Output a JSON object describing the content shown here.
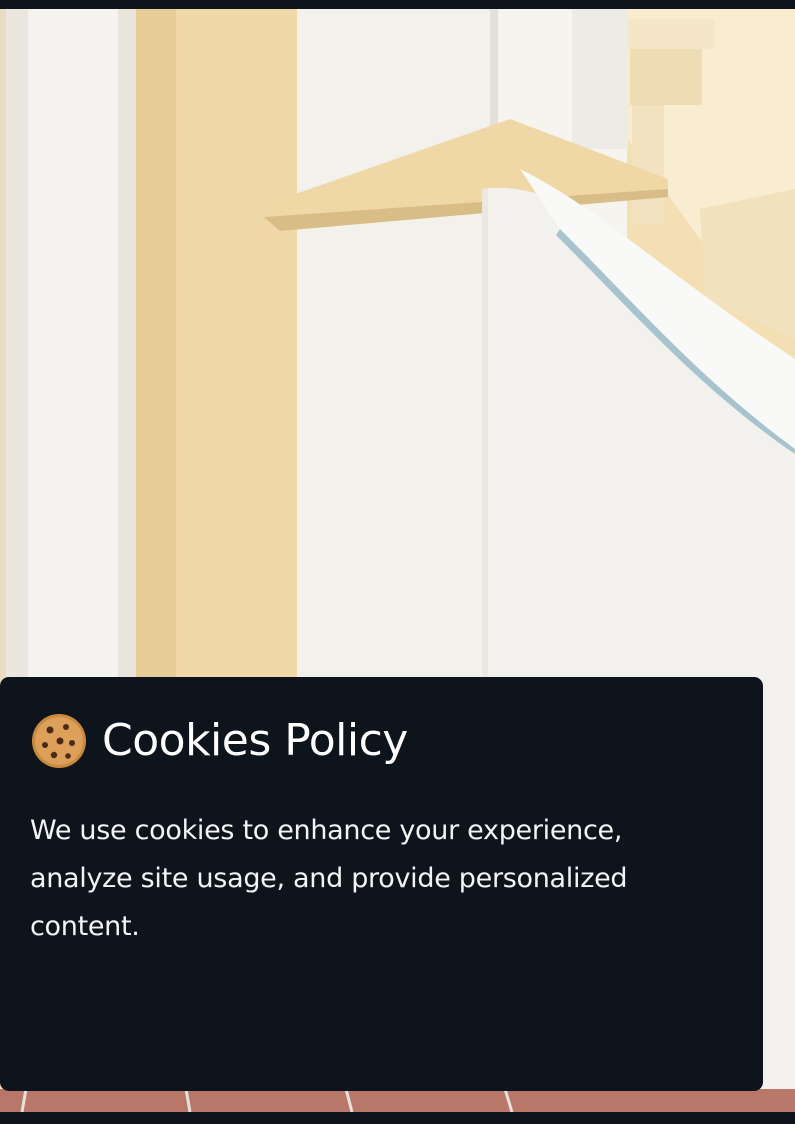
{
  "cookie_banner": {
    "icon": "cookie-icon",
    "title": "Cookies Policy",
    "text": "We use cookies to enhance your experience, analyze site usage, and provide personalized content."
  },
  "colors": {
    "banner_background": "#0e141b",
    "banner_text": "#ffffff",
    "wall_light": "#f4f1ea",
    "wall_warm": "#efd9a8",
    "tile": "#b9776a"
  }
}
